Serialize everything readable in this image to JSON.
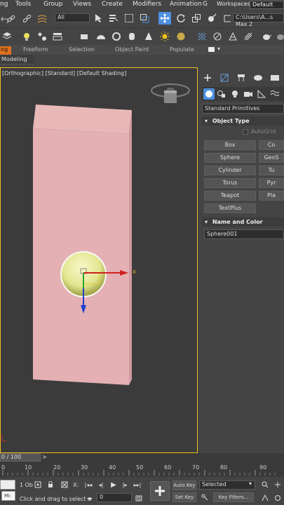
{
  "menu": {
    "items": [
      "ng",
      "Tools",
      "Group",
      "Views",
      "Create",
      "Modifiers",
      "Animation",
      "G"
    ],
    "workspaces_label": "Workspaces:",
    "workspace_value": "Default"
  },
  "toolbar": {
    "filter_value": "All",
    "path_value": "C:\\Users\\A...s Max 2"
  },
  "ribbon_tabs": [
    "ng",
    "Freeform",
    "Selection",
    "Object Paint",
    "Populate"
  ],
  "ribbon_sub": "Modeling",
  "viewport": {
    "label": "[Orthographic] [Standard] [Default Shading]",
    "axis_x": "X"
  },
  "command_panel": {
    "category_value": "Standard Primitives",
    "object_type_title": "Object Type",
    "autogrid_label": "AutoGrid",
    "buttons": [
      [
        "Box",
        "Co"
      ],
      [
        "Sphere",
        "GeoS"
      ],
      [
        "Cylinder",
        "Tu"
      ],
      [
        "Torus",
        "Pyr"
      ],
      [
        "Teapot",
        "Pla"
      ],
      [
        "TextPlus",
        ""
      ]
    ],
    "name_color_title": "Name and Color",
    "object_name": "Sphere001"
  },
  "timeline": {
    "frame_readout": "0 / 100",
    "ticks": [
      "0",
      "10",
      "20",
      "30",
      "40",
      "50",
      "60",
      "70",
      "80",
      "90"
    ]
  },
  "status": {
    "maxscript": "Mi:",
    "selected_count": "1 Ob",
    "coord_x_label": "X:",
    "prompt": "Click and drag to select a",
    "frame_value": "0",
    "auto_key": "Auto Key",
    "set_key": "Set Key",
    "selected_value": "Selected",
    "key_filters": "Key Filters..."
  },
  "colors": {
    "accent_orange": "#e07020",
    "viewport_border": "#f0c020",
    "box_face": "#e8b8b8",
    "sphere": "#e8ea9a",
    "panel_button_active": "#4d8fe0"
  }
}
